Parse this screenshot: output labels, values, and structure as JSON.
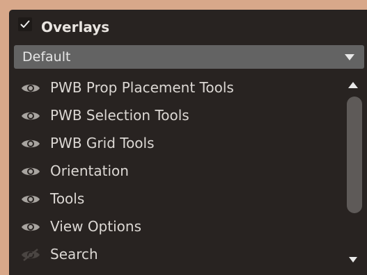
{
  "overlays_panel": {
    "title": "Overlays",
    "checked": true,
    "preset_dropdown": {
      "selected": "Default"
    },
    "items": [
      {
        "label": "PWB Prop Placement Tools",
        "visible": true
      },
      {
        "label": "PWB Selection Tools",
        "visible": true
      },
      {
        "label": "PWB Grid Tools",
        "visible": true
      },
      {
        "label": "Orientation",
        "visible": true
      },
      {
        "label": "Tools",
        "visible": true
      },
      {
        "label": "View Options",
        "visible": true
      },
      {
        "label": "Search",
        "visible": false
      }
    ]
  },
  "colors": {
    "panel_bg": "#282321",
    "dropdown_bg": "#636363",
    "text": "#dcd8d4",
    "icon_visible": "#a8a4a0",
    "icon_hidden": "#4a4542",
    "outer_bg": "#d8a88a"
  },
  "icons": {
    "checkbox": "checkmark-icon",
    "dropdown": "triangle-down-icon",
    "visible": "eye-icon",
    "hidden": "eye-slash-icon",
    "scroll_up": "triangle-up-icon",
    "scroll_down": "triangle-down-icon"
  }
}
